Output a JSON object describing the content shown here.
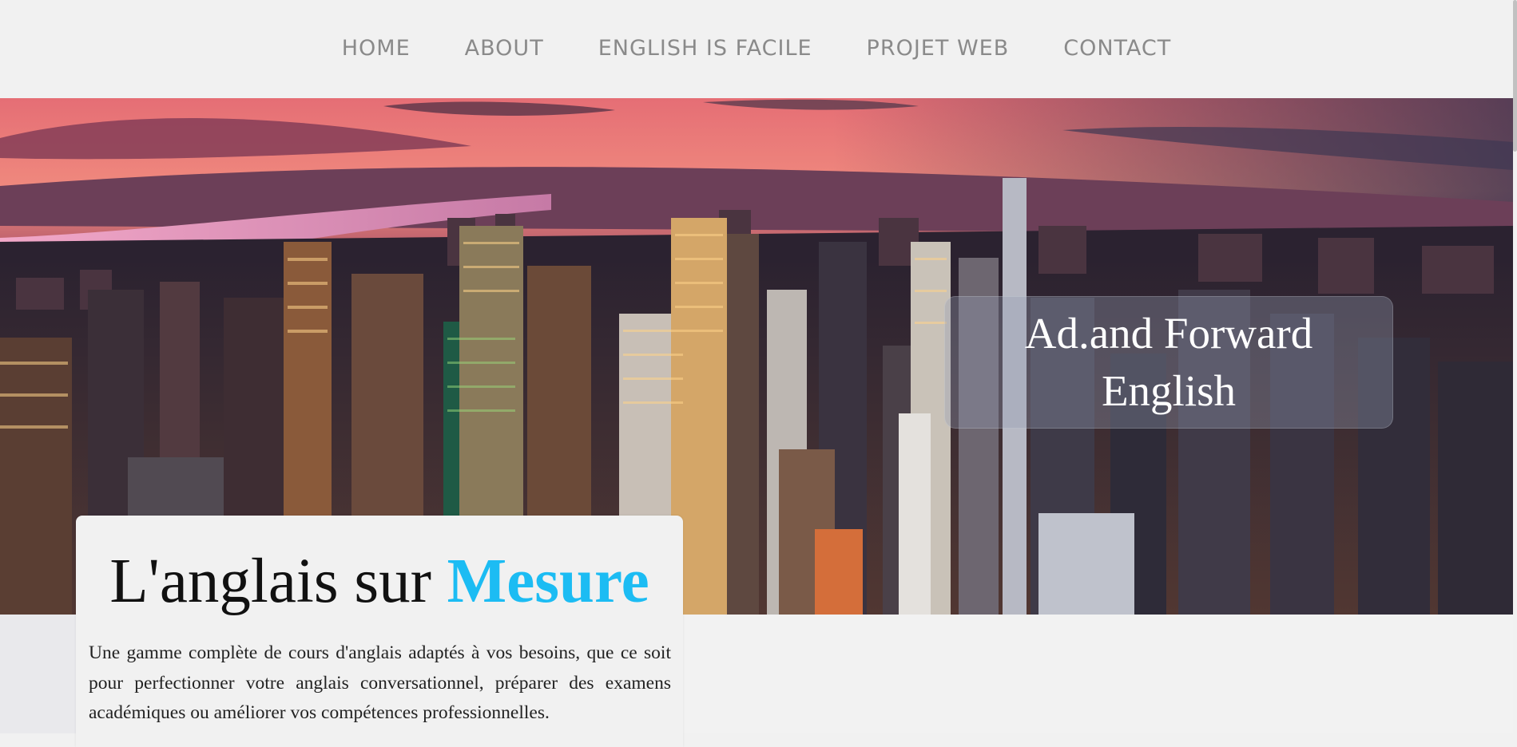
{
  "nav": {
    "items": [
      "HOME",
      "ABOUT",
      "ENGLISH IS FACILE",
      "PROJET WEB",
      "CONTACT"
    ]
  },
  "hero": {
    "image": "city-skyline-sunset-photo",
    "box_line1": "Ad.and Forward",
    "box_line2": "English"
  },
  "card": {
    "title_part1": "L'anglais sur ",
    "title_accent": "Mesure",
    "accent_color": "#1cbcf3",
    "description": "Une gamme complète de cours d'anglais adaptés à vos besoins, que ce soit pour perfectionner votre anglais conversationnel, préparer des examens académiques ou améliorer vos compétences professionnelles."
  }
}
